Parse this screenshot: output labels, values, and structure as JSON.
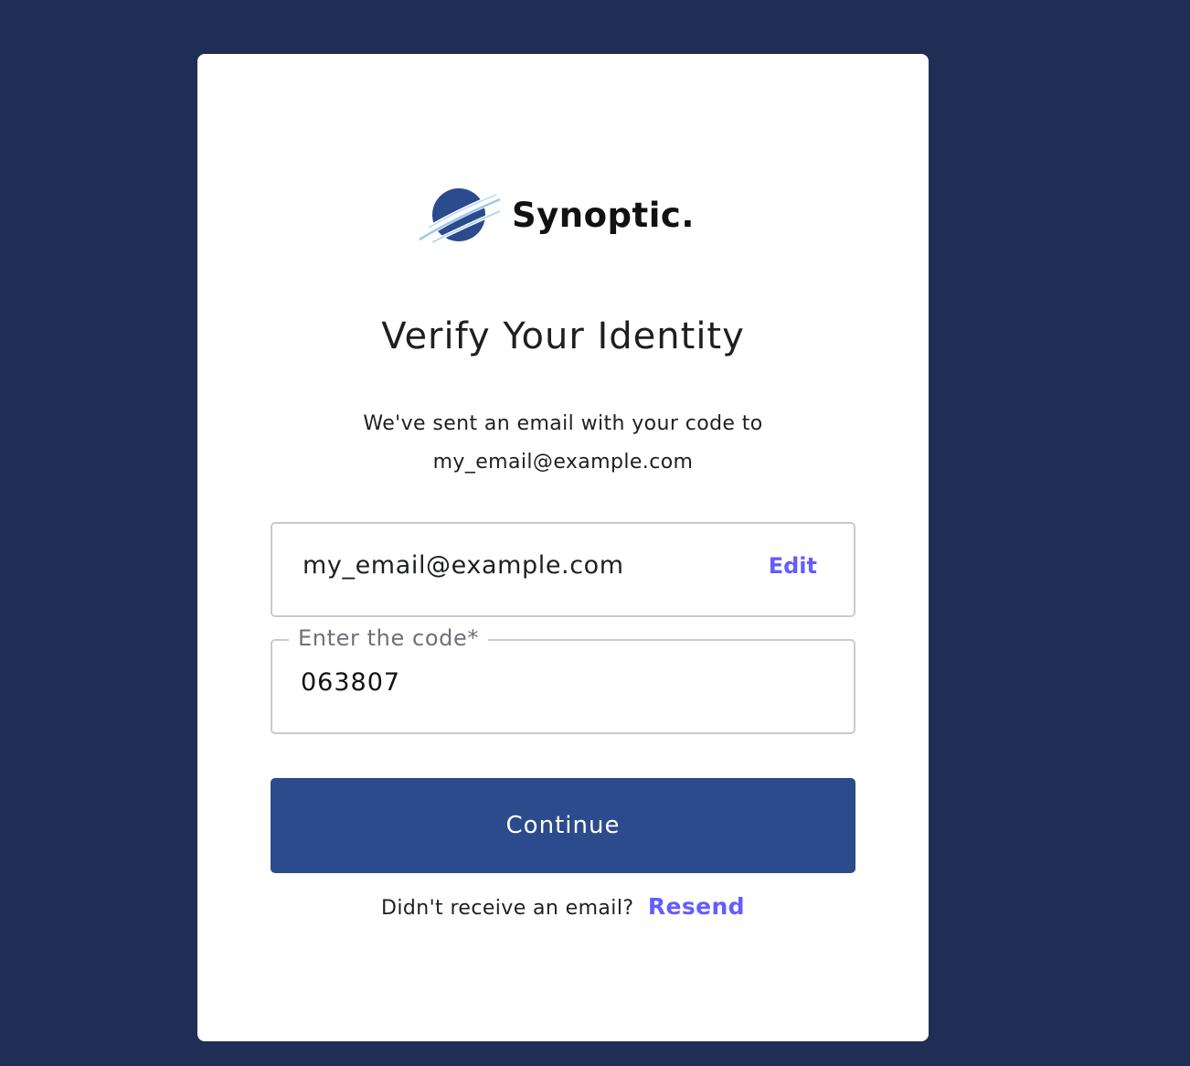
{
  "brand": {
    "name": "Synoptic.",
    "logo_icon": "synoptic-planet-logo",
    "colors": {
      "background": "#1f2e55",
      "primary": "#2b4b8d",
      "link": "#635dff"
    }
  },
  "header": {
    "title": "Verify Your Identity",
    "description_line1": "We've sent an email with your code to",
    "description_line2": "my_email@example.com"
  },
  "form": {
    "email_value": "my_email@example.com",
    "edit_label": "Edit",
    "code_label": "Enter the code*",
    "code_value": "063807",
    "submit_label": "Continue"
  },
  "footer": {
    "prompt_text": "Didn't receive an email?",
    "resend_label": "Resend"
  }
}
